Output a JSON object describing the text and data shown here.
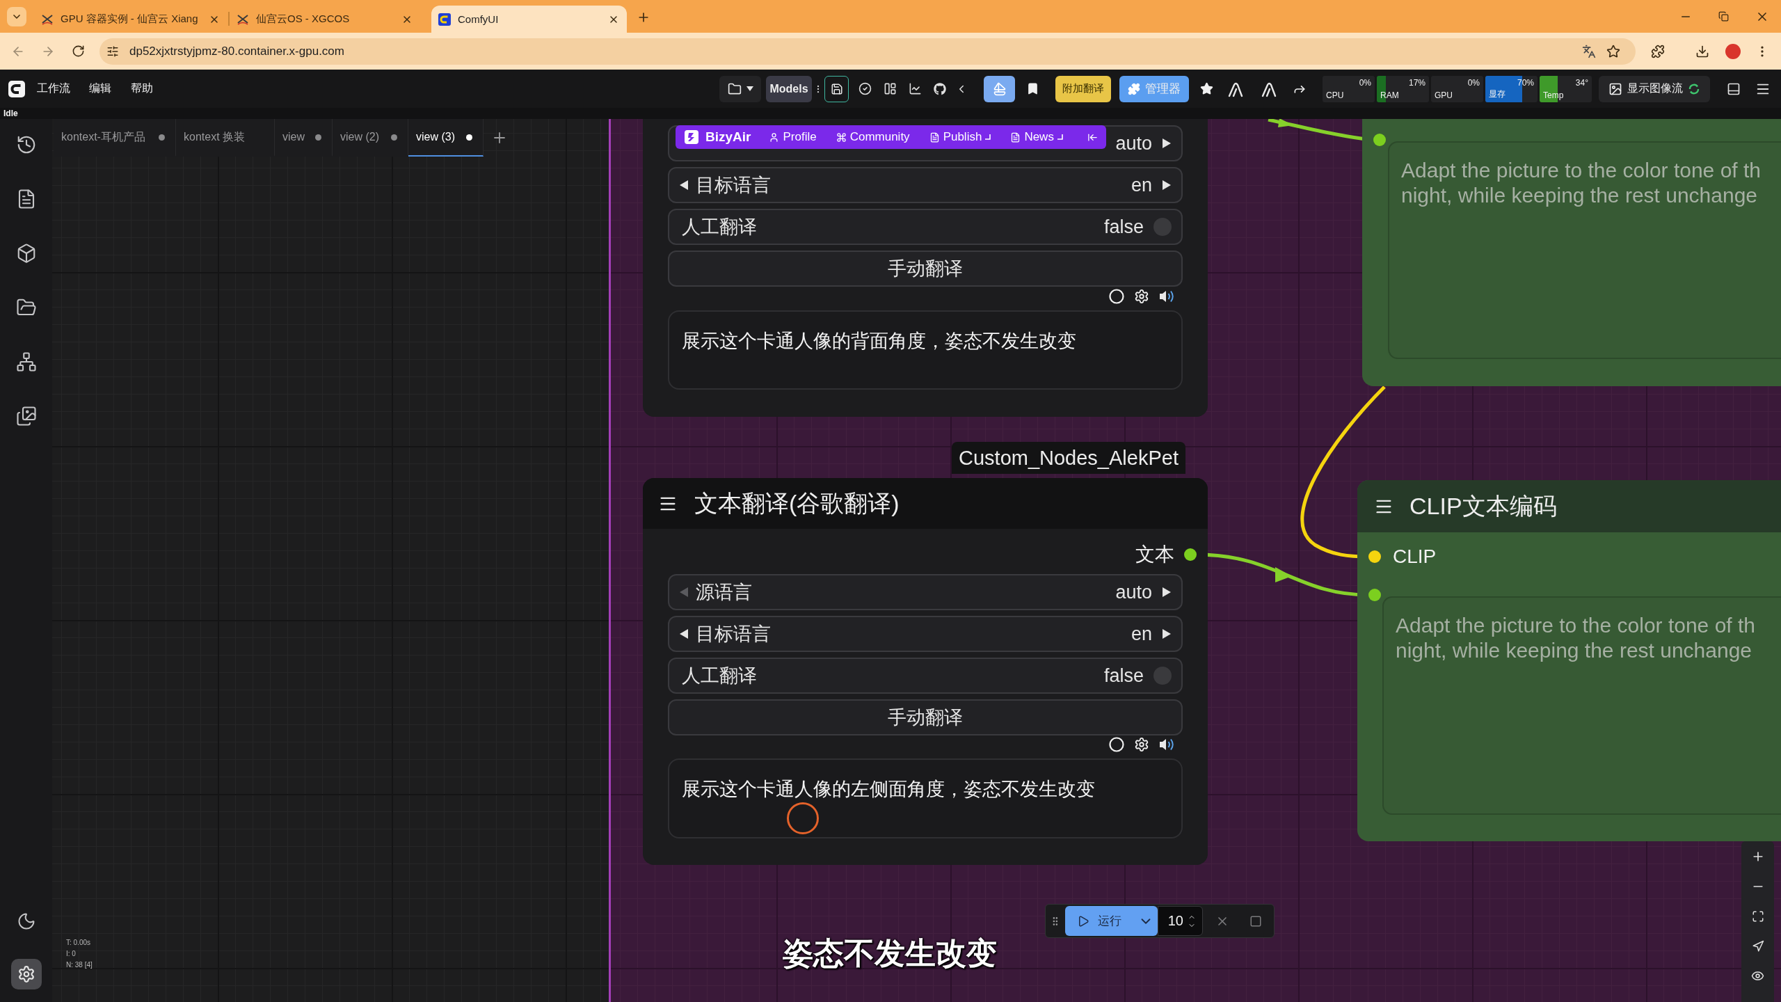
{
  "browser": {
    "tabs": [
      {
        "title": "GPU 容器实例 - 仙宫云 Xiang",
        "selected": false
      },
      {
        "title": "仙宫云OS - XGCOS",
        "selected": false
      },
      {
        "title": "ComfyUI",
        "selected": true
      }
    ],
    "url": "dp52xjxtrstyjpmz-80.container.x-gpu.com"
  },
  "menu": {
    "items": [
      "工作流",
      "编辑",
      "帮助"
    ],
    "models": "Models",
    "translate": "附加翻译",
    "manager": "管理器",
    "monitors": [
      {
        "label": "CPU",
        "reading": "0%"
      },
      {
        "label": "RAM",
        "reading": "17%",
        "level": 0.17,
        "color": "#1b6e22"
      },
      {
        "label": "GPU",
        "reading": "0%"
      },
      {
        "label": "显存",
        "reading": "70%",
        "level": 0.7,
        "color": "#1565c0"
      },
      {
        "label": "Temp",
        "reading": "34°",
        "level": 0.34,
        "color": "#3f9a2a"
      }
    ],
    "image_feed": "显示图像流"
  },
  "status": "Idle",
  "workflow_tabs": [
    {
      "label": "kontext-耳机产品",
      "modified": true,
      "selected": false
    },
    {
      "label": "kontext 换装",
      "modified": false,
      "selected": false
    },
    {
      "label": "view",
      "modified": true,
      "selected": false
    },
    {
      "label": "view (2)",
      "modified": true,
      "selected": false
    },
    {
      "label": "view (3)",
      "modified": true,
      "selected": true
    }
  ],
  "bizyair": {
    "brand": "BizyAir",
    "links": [
      {
        "label": "Profile",
        "external": false
      },
      {
        "label": "Community",
        "external": false
      },
      {
        "label": "Publish",
        "external": true
      },
      {
        "label": "News",
        "external": true
      }
    ]
  },
  "translate_nodes": [
    {
      "widgets": [
        {
          "kind": "combo",
          "value": "auto"
        },
        {
          "kind": "combo",
          "label": "目标语言",
          "value": "en",
          "prev_disabled": false
        },
        {
          "kind": "toggle",
          "label": "人工翻译",
          "value": "false",
          "on": false
        },
        {
          "kind": "button",
          "label": "手动翻译"
        }
      ],
      "text": "展示这个卡通人像的背面角度，姿态不发生改变"
    },
    {
      "badge": "Custom_Nodes_AlekPet",
      "title": "文本翻译(谷歌翻译)",
      "output": "文本",
      "widgets": [
        {
          "kind": "combo",
          "label": "源语言",
          "value": "auto",
          "prev_disabled": true
        },
        {
          "kind": "combo",
          "label": "目标语言",
          "value": "en",
          "prev_disabled": false
        },
        {
          "kind": "toggle",
          "label": "人工翻译",
          "value": "false",
          "on": false
        },
        {
          "kind": "button",
          "label": "手动翻译"
        }
      ],
      "text": "展示这个卡通人像的左侧面角度，姿态不发生改变"
    }
  ],
  "text_nodes": [
    {
      "value": "Adapt the picture to the color tone of th\nnight, while keeping the rest unchange"
    },
    {
      "title": "CLIP文本编码",
      "input": "CLIP",
      "value": "Adapt the picture to the color tone of th\nnight, while keeping the rest unchange"
    }
  ],
  "run_bar": {
    "label": "运行",
    "count": "10"
  },
  "stats": [
    "T: 0.00s",
    "I: 0",
    "N: 38 [4]"
  ],
  "subtitle": "姿态不发生改变"
}
